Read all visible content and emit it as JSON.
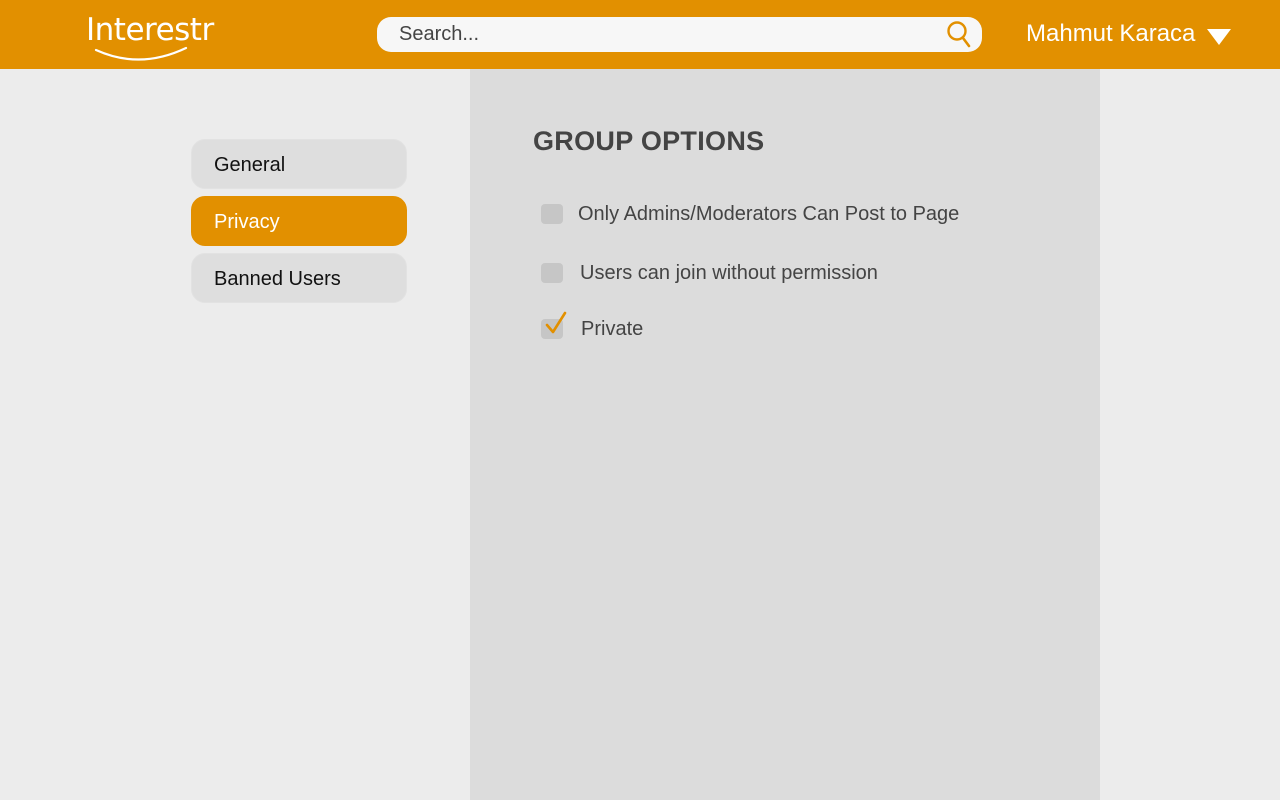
{
  "header": {
    "logo_text": "Interestr",
    "search_placeholder": "Search...",
    "user_name": "Mahmut Karaca"
  },
  "sidebar": {
    "items": [
      {
        "label": "General",
        "active": false
      },
      {
        "label": "Privacy",
        "active": true
      },
      {
        "label": "Banned Users",
        "active": false
      }
    ]
  },
  "main": {
    "title": "GROUP OPTIONS",
    "options": [
      {
        "label": "Only Admins/Moderators Can Post to Page",
        "checked": false
      },
      {
        "label": "Users can join without permission",
        "checked": false
      },
      {
        "label": "Private",
        "checked": true
      }
    ]
  },
  "colors": {
    "accent": "#e29000",
    "panel": "#dcdcdc",
    "background": "#ececec"
  },
  "icons": {
    "search": "search-icon",
    "user_menu": "caret-down-icon",
    "checked": "checkmark-icon"
  }
}
